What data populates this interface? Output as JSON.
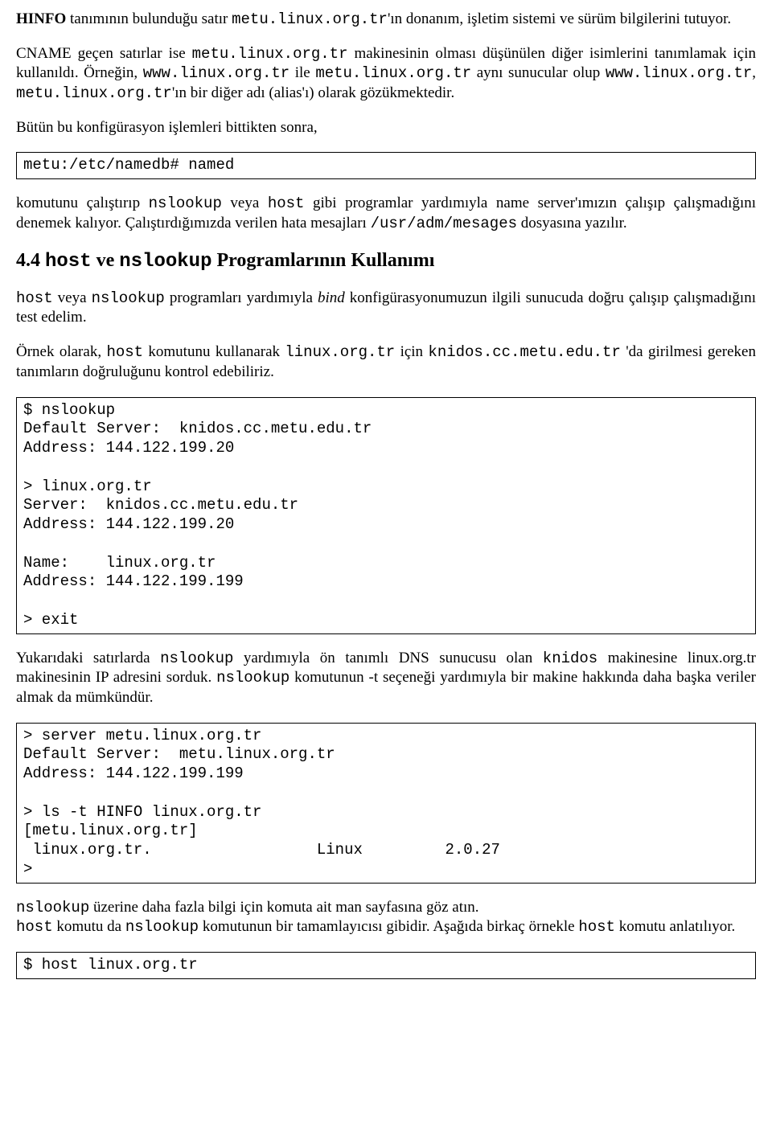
{
  "p1": {
    "t1": "HINFO",
    "t2": " tanımının bulunduğu satır ",
    "t3": "metu.linux.org.tr",
    "t4": "'ın donanım, işletim sistemi ve sürüm bilgilerini tutuyor."
  },
  "p2": {
    "t1": "CNAME geçen satırlar ise ",
    "t2": "metu.linux.org.tr",
    "t3": " makinesinin olması düşünülen diğer isimlerini tanımlamak için kullanıldı. Örneğin, ",
    "t4": "www.linux.org.tr",
    "t5": " ile ",
    "t6": "metu.linux.org.tr",
    "t7": " aynı sunucular olup ",
    "t8": "www.linux.org.tr",
    "t9": ", ",
    "t10": "metu.linux.org.tr",
    "t11": "'ın bir diğer adı (alias'ı) olarak gözükmektedir."
  },
  "p3": "Bütün bu konfigürasyon işlemleri bittikten sonra,",
  "code1": "metu:/etc/namedb# named",
  "p4": {
    "t1": "komutunu çalıştırıp ",
    "t2": "nslookup",
    "t3": " veya ",
    "t4": "host",
    "t5": " gibi programlar yardımıyla name server'ımızın çalışıp çalışmadığını denemek kalıyor. Çalıştırdığımızda verilen hata mesajları ",
    "t6": "/usr/adm/mesages",
    "t7": " dosyasına yazılır."
  },
  "h2": {
    "t1": "4.4 ",
    "t2": "host",
    "t3": " ve ",
    "t4": "nslookup",
    "t5": " Programlarının Kullanımı"
  },
  "p5": {
    "t1": "host",
    "t2": " veya ",
    "t3": "nslookup",
    "t4": " programları yardımıyla ",
    "t5": "bind",
    "t6": " konfigürasyonumuzun ilgili sunucuda doğru çalışıp çalışmadığını test edelim."
  },
  "p6": {
    "t1": "Örnek olarak, ",
    "t2": "host",
    "t3": " komutunu kullanarak ",
    "t4": "linux.org.tr",
    "t5": " için ",
    "t6": "knidos.cc.metu.edu.tr",
    "t7": " 'da girilmesi gereken tanımların doğruluğunu kontrol edebiliriz."
  },
  "code2": "$ nslookup\nDefault Server:  knidos.cc.metu.edu.tr\nAddress: 144.122.199.20\n\n> linux.org.tr\nServer:  knidos.cc.metu.edu.tr\nAddress: 144.122.199.20\n\nName:    linux.org.tr\nAddress: 144.122.199.199\n\n> exit",
  "p7": {
    "t1": "Yukarıdaki satırlarda ",
    "t2": "nslookup",
    "t3": " yardımıyla ön tanımlı DNS sunucusu olan ",
    "t4": "knidos",
    "t5": " makinesine linux.org.tr makinesinin IP adresini sorduk. ",
    "t6": "nslookup",
    "t7": " komutunun -t seçeneği yardımıyla bir makine hakkında daha başka veriler almak da mümkündür."
  },
  "code3": "> server metu.linux.org.tr\nDefault Server:  metu.linux.org.tr\nAddress: 144.122.199.199\n\n> ls -t HINFO linux.org.tr\n[metu.linux.org.tr]\n linux.org.tr.                  Linux         2.0.27\n>",
  "p8": {
    "t1": "nslookup",
    "t2": " üzerine daha fazla bilgi için komuta ait man sayfasına göz atın."
  },
  "p9": {
    "t1": "host",
    "t2": " komutu da ",
    "t3": "nslookup",
    "t4": " komutunun bir tamamlayıcısı gibidir. Aşağıda birkaç örnekle ",
    "t5": "host",
    "t6": " komutu anlatılıyor."
  },
  "code4": "$ host linux.org.tr"
}
